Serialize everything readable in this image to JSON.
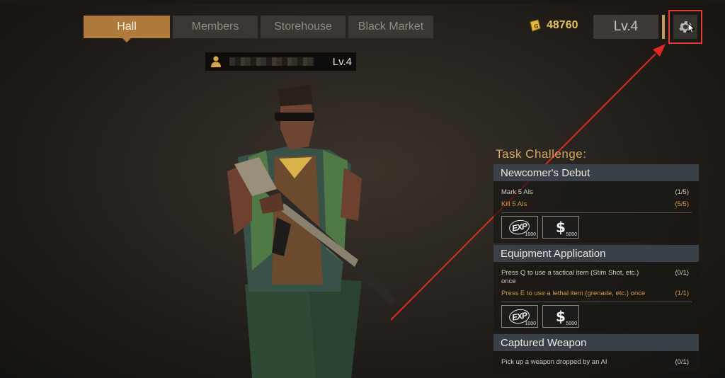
{
  "tabs": [
    {
      "label": "Hall",
      "active": true
    },
    {
      "label": "Members",
      "active": false
    },
    {
      "label": "Storehouse",
      "active": false
    },
    {
      "label": "Black Market",
      "active": false
    }
  ],
  "currency": {
    "icon": "coin-ticket-icon",
    "value": "48760"
  },
  "level_badge": "Lv.4",
  "settings": {
    "icon": "gear-icon"
  },
  "player": {
    "icon": "person-icon",
    "level": "Lv.4"
  },
  "tasks": {
    "title": "Task Challenge:",
    "items": [
      {
        "name": "Newcomer's Debut",
        "objectives": [
          {
            "text": "Mark 5 AIs",
            "progress": "(1/5)",
            "done": false
          },
          {
            "text": "Kill 5 AIs",
            "progress": "(5/5)",
            "done": true
          }
        ],
        "rewards": [
          {
            "icon": "exp-icon",
            "amount": "1000"
          },
          {
            "icon": "dollar-icon",
            "amount": "5000"
          }
        ]
      },
      {
        "name": "Equipment Application",
        "objectives": [
          {
            "text": "Press Q to use a tactical item (Stim Shot, etc.) once",
            "progress": "(0/1)",
            "done": false
          },
          {
            "text": "Press E to use a lethal item (grenade, etc.) once",
            "progress": "(1/1)",
            "done": true
          }
        ],
        "rewards": [
          {
            "icon": "exp-icon",
            "amount": "1000"
          },
          {
            "icon": "dollar-icon",
            "amount": "5000"
          }
        ]
      },
      {
        "name": "Captured Weapon",
        "objectives": [
          {
            "text": "Pick up a weapon dropped by an AI",
            "progress": "(0/1)",
            "done": false
          }
        ]
      }
    ]
  },
  "colors": {
    "accent": "#b07a3c",
    "done_text": "#d49845",
    "highlight": "#e23b2e",
    "coin": "#e6c35a"
  }
}
